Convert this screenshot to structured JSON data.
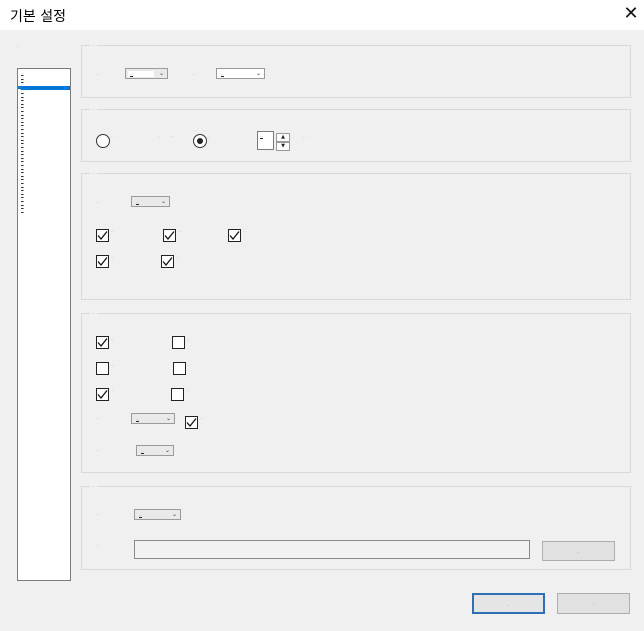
{
  "window": {
    "title": "기본 설정",
    "close_glyph": "✕"
  },
  "sidebar": {
    "label": "…",
    "items": [
      "…",
      "…",
      "…",
      "…",
      "…",
      "…",
      "…",
      "…",
      "…",
      "…",
      "…",
      "…",
      "…",
      "…",
      "…",
      "…",
      "…",
      "…",
      "…",
      "…",
      "…",
      "…",
      "…",
      "…",
      "…",
      "…",
      "…",
      "…",
      "…",
      "…",
      "…",
      "…",
      "…",
      "…",
      "…",
      "…",
      "…",
      "…",
      "…"
    ],
    "selected_index": 4
  },
  "section1": {
    "legend": "…",
    "label_a": "…",
    "combo_a_value": "…",
    "label_b": "…",
    "combo_b_value": "…"
  },
  "section2": {
    "legend": "…",
    "radio1_label": "…",
    "mid_label": "…",
    "radio2_label": "…",
    "spin_value": "…",
    "spin_unit": "…",
    "radio1_checked": false,
    "radio2_checked": true
  },
  "section3": {
    "legend": "…",
    "combo_label": "…",
    "combo_value": "…",
    "checks": [
      {
        "label": "…",
        "checked": true
      },
      {
        "label": "…",
        "checked": true
      },
      {
        "label": "…",
        "checked": true
      },
      {
        "label": "…",
        "checked": true
      },
      {
        "label": "…",
        "checked": true
      }
    ]
  },
  "section4": {
    "legend": "…",
    "checks": [
      {
        "label": "…",
        "checked": true
      },
      {
        "label": "…",
        "checked": false
      },
      {
        "label": "…",
        "checked": false
      },
      {
        "label": "…",
        "checked": false
      },
      {
        "label": "…",
        "checked": true
      },
      {
        "label": "…",
        "checked": false
      }
    ],
    "combo_label": "…",
    "combo_value": "…",
    "extra_check": {
      "label": "…",
      "checked": true
    },
    "combo2_label": "…",
    "combo2_value": "…"
  },
  "section5": {
    "legend": "…",
    "combo_label": "…",
    "combo_value": "…",
    "path_label": "…",
    "path_value": "",
    "browse_label": "…"
  },
  "footer": {
    "ok_label": "…",
    "cancel_label": "…"
  },
  "icons": {
    "chevron": "⌄",
    "spin_up": "▲",
    "spin_down": "▼"
  }
}
